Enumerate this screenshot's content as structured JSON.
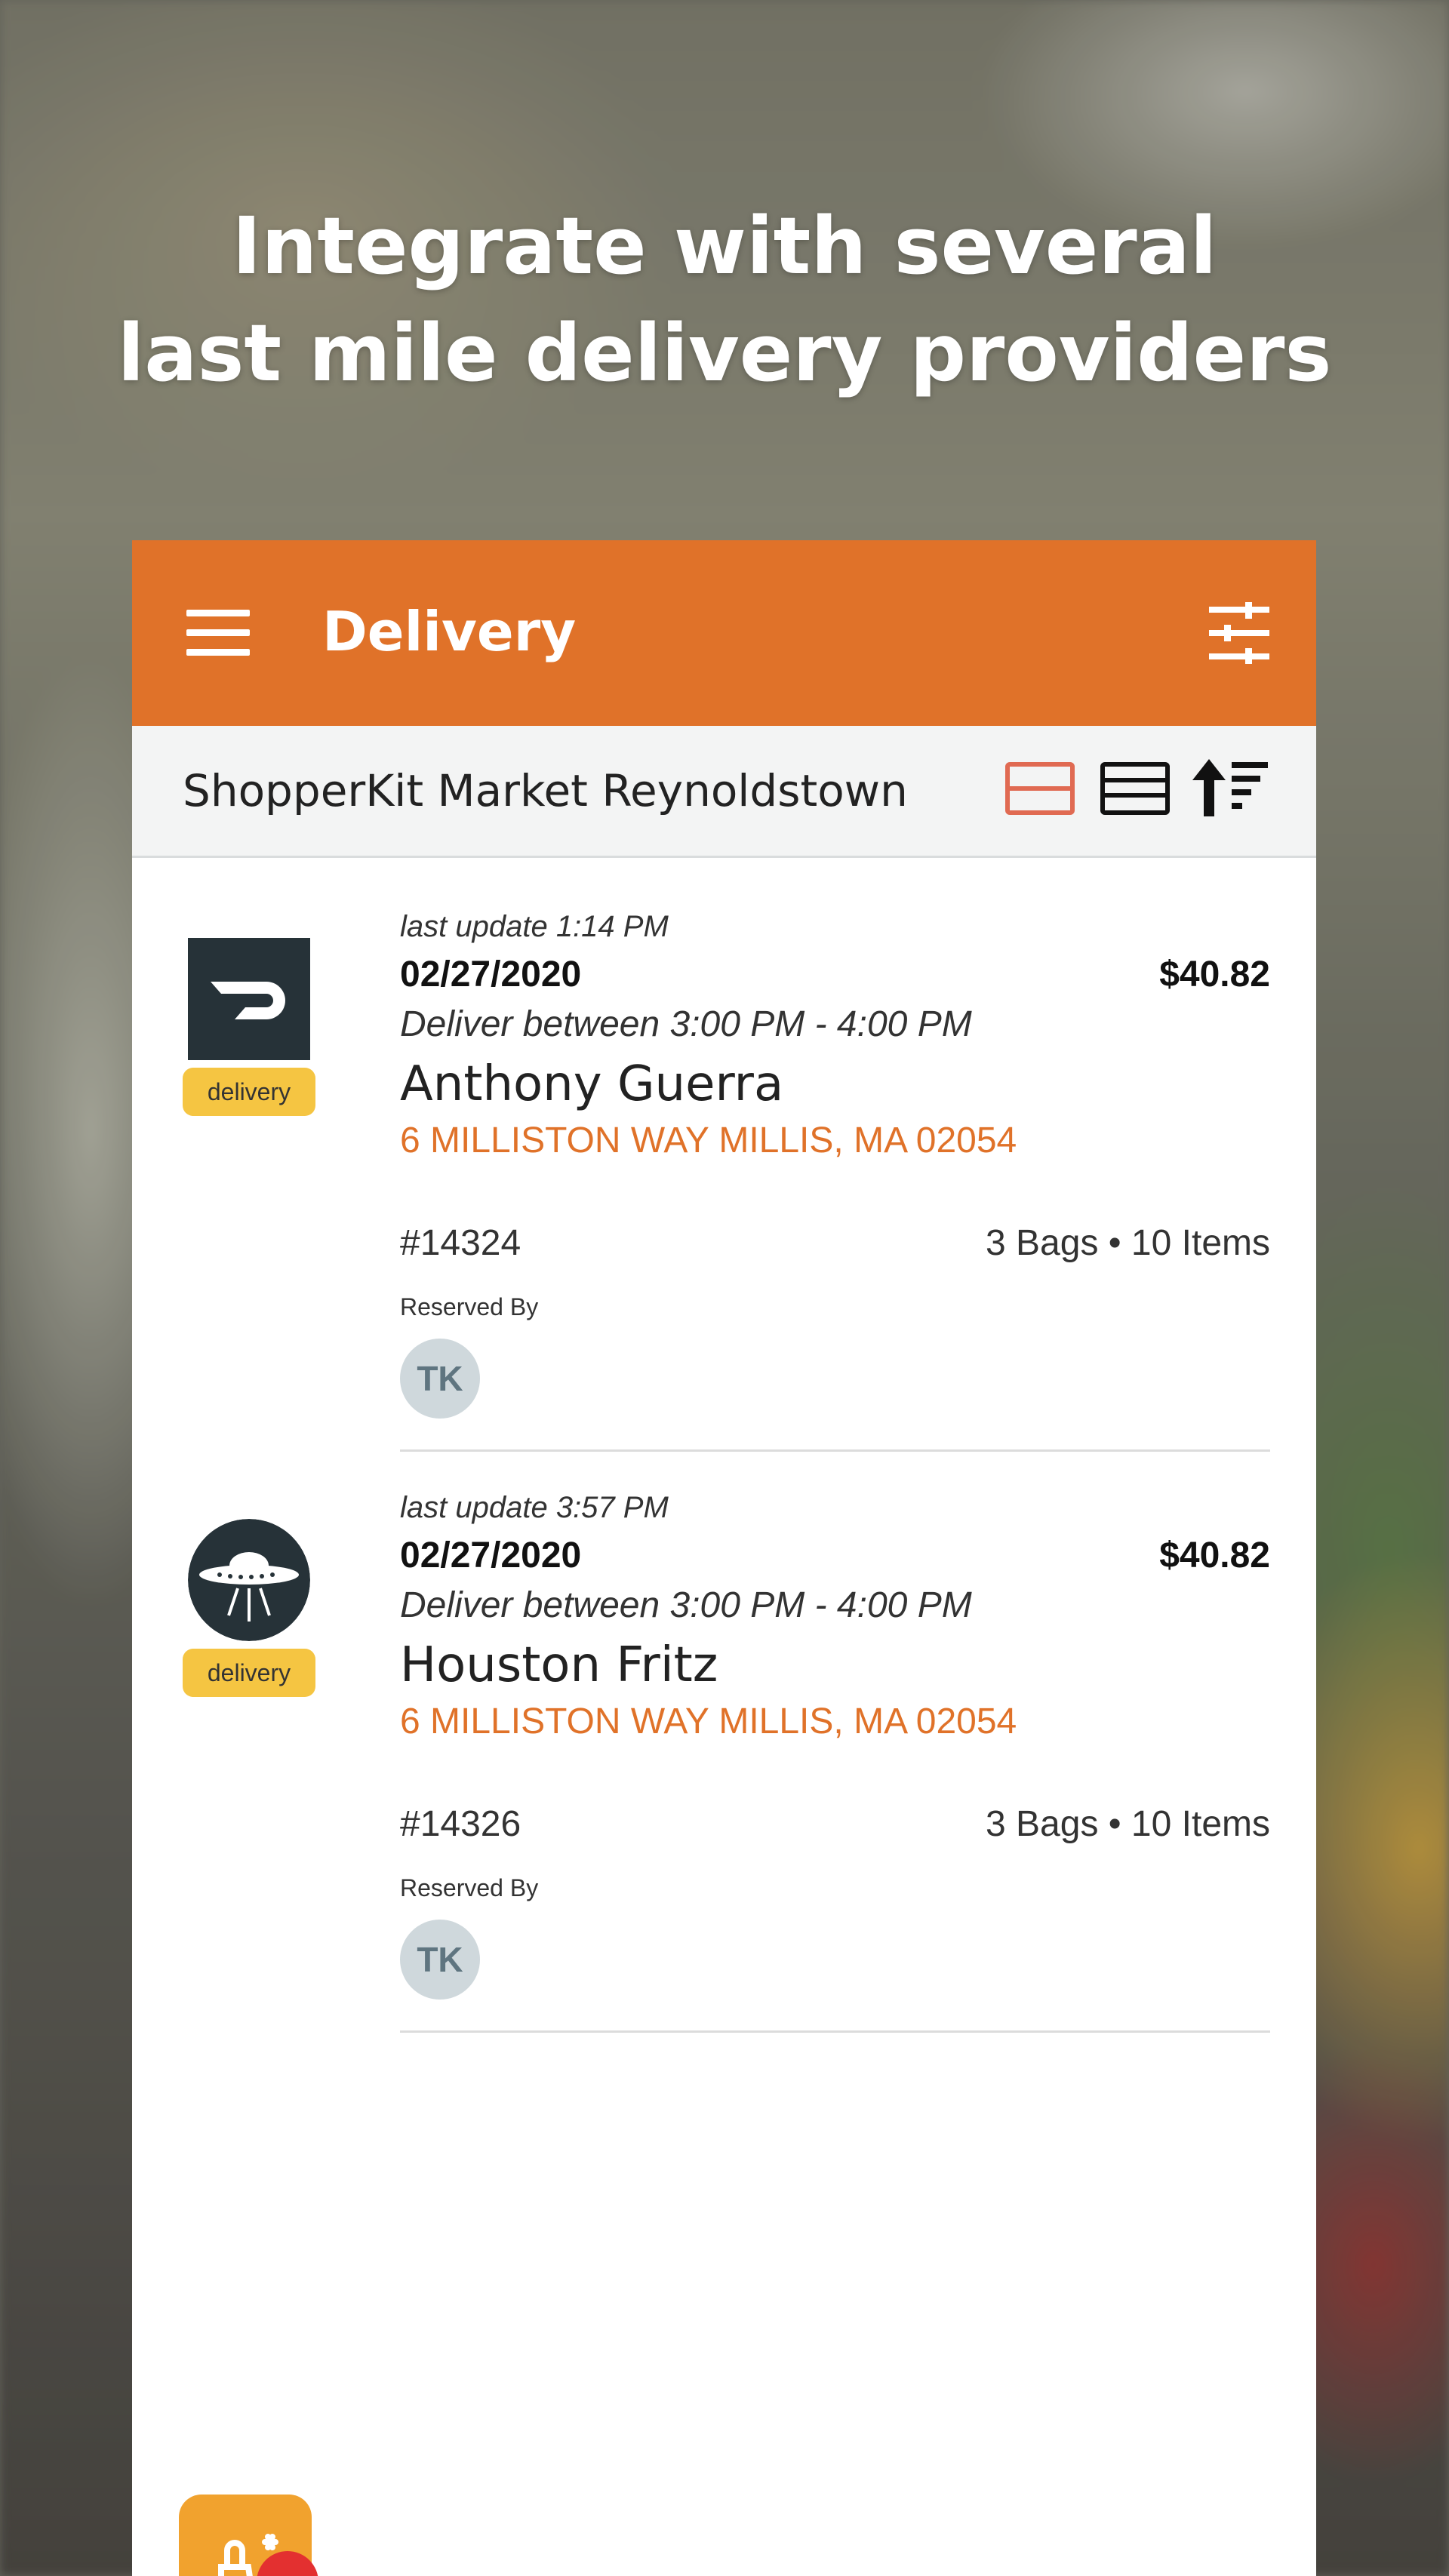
{
  "headline": {
    "line1": "Integrate with several",
    "line2": "last mile delivery providers"
  },
  "appbar": {
    "title": "Delivery",
    "menu_icon": "hamburger-menu-icon",
    "filter_icon": "sliders-filter-icon"
  },
  "store": {
    "name": "ShopperKit Market Reynoldstown",
    "active_view": "card",
    "icons": [
      "card-view-icon",
      "list-view-icon",
      "sort-icon"
    ]
  },
  "colors": {
    "accent": "#e07229",
    "tag": "#f5c542",
    "avatar_bg": "#cfd8dc",
    "fab": "#f1a22e",
    "badge": "#e33030"
  },
  "orders": [
    {
      "provider_icon": "doordash-logo-icon",
      "tag": "delivery",
      "last_update": "last update 1:14 PM",
      "date": "02/27/2020",
      "price": "$40.82",
      "window": "Deliver between  3:00 PM - 4:00 PM",
      "customer": "Anthony Guerra",
      "address": "6 MILLISTON WAY  MILLIS, MA 02054",
      "order_number": "#14324",
      "bags_items": "3 Bags • 10 Items",
      "reserved_label": "Reserved By",
      "reserved_initials": "TK"
    },
    {
      "provider_icon": "ufo-logo-icon",
      "tag": "delivery",
      "last_update": "last update 3:57 PM",
      "date": "02/27/2020",
      "price": "$40.82",
      "window": "Deliver between  3:00 PM - 4:00 PM",
      "customer": "Houston Fritz",
      "address": "6 MILLISTON WAY  MILLIS, MA 02054",
      "order_number": "#14326",
      "bags_items": "3 Bags • 10 Items",
      "reserved_label": "Reserved By",
      "reserved_initials": "TK"
    }
  ],
  "fab": {
    "icon": "shopper-cart-icon"
  }
}
